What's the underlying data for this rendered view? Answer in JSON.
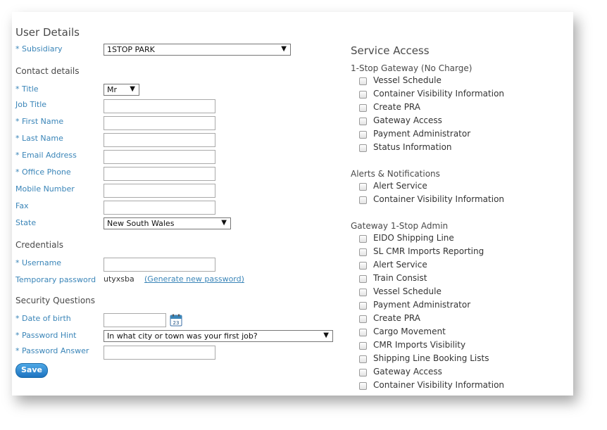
{
  "user_details": {
    "title": "User Details",
    "subsidiary_label": "* Subsidiary",
    "subsidiary_value": "1STOP PARK"
  },
  "contact": {
    "heading": "Contact details",
    "title_label": "* Title",
    "title_value": "Mr",
    "job_title_label": "Job Title",
    "first_name_label": "* First Name",
    "last_name_label": "* Last Name",
    "email_label": "* Email Address",
    "office_phone_label": "* Office Phone",
    "mobile_label": "Mobile Number",
    "fax_label": "Fax",
    "state_label": "State",
    "state_value": "New South Wales"
  },
  "credentials": {
    "heading": "Credentials",
    "username_label": "* Username",
    "temp_password_label": "Temporary password",
    "temp_password_value": "utyxsba",
    "generate_link": "(Generate new password)"
  },
  "security": {
    "heading": "Security Questions",
    "dob_label": "* Date of birth",
    "calendar_day": "23",
    "hint_label": "* Password Hint",
    "hint_value": "In what city or town was your first job?",
    "answer_label": "* Password Answer"
  },
  "save_label": "Save",
  "service_access": {
    "title": "Service Access",
    "groups": [
      {
        "name": "1-Stop Gateway (No Charge)",
        "items": [
          "Vessel Schedule",
          "Container Visibility Information",
          "Create PRA",
          "Gateway Access",
          "Payment Administrator",
          "Status Information"
        ]
      },
      {
        "name": "Alerts & Notifications",
        "items": [
          "Alert Service",
          "Container Visibility Information"
        ]
      },
      {
        "name": "Gateway 1-Stop Admin",
        "items": [
          "EIDO Shipping Line",
          "SL CMR Imports Reporting",
          "Alert Service",
          "Train Consist",
          "Vessel Schedule",
          "Payment Administrator",
          "Create PRA",
          "Cargo Movement",
          "CMR Imports Visibility",
          "Shipping Line Booking Lists",
          "Gateway Access",
          "Container Visibility Information"
        ]
      }
    ]
  }
}
